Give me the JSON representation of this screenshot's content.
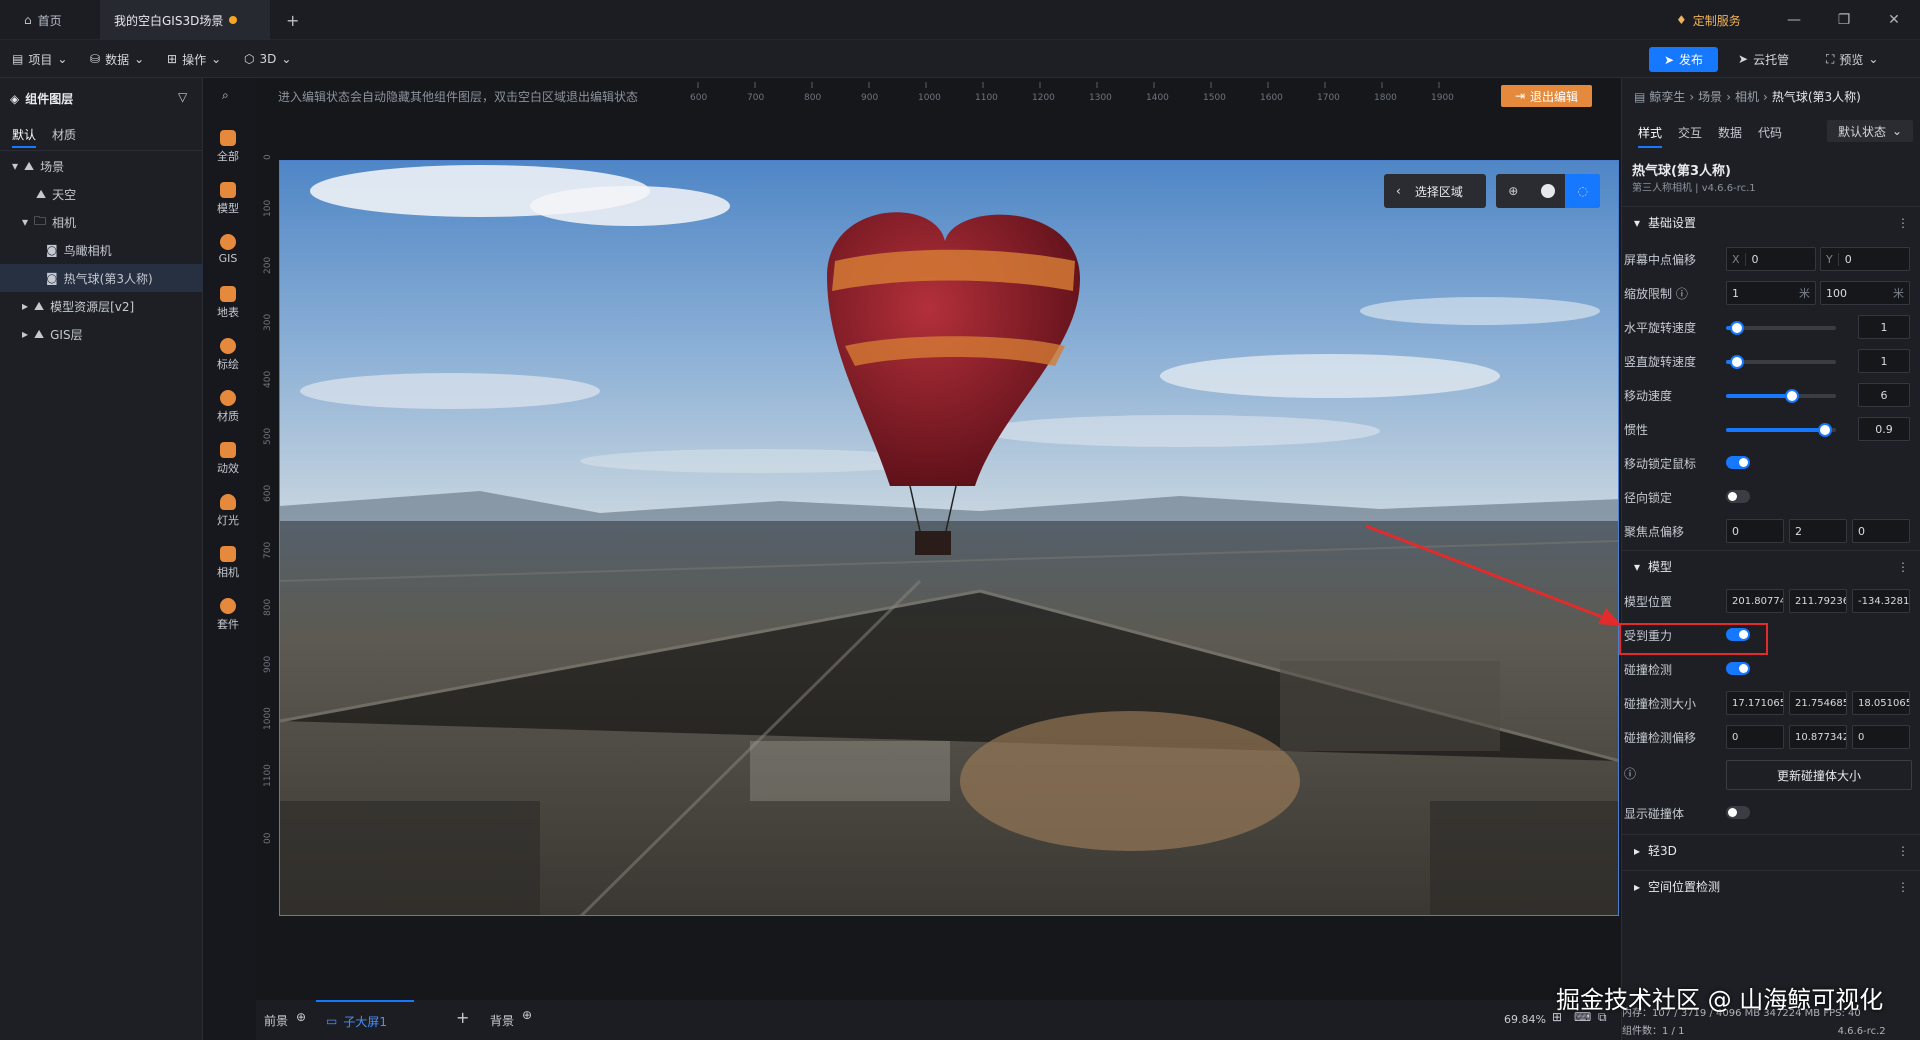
{
  "titlebar": {
    "home_tab": "首页",
    "scene_tab": "我的空白GIS3D场景",
    "custom_service": "定制服务"
  },
  "menubar": {
    "project": "项目",
    "data": "数据",
    "operate": "操作",
    "mode": "3D",
    "publish": "发布",
    "cloud": "云托管",
    "preview": "预览"
  },
  "left_panel": {
    "title": "组件图层",
    "tabs": [
      "默认",
      "材质"
    ],
    "tree": [
      {
        "label": "场景",
        "expanded": true
      },
      {
        "label": "天空"
      },
      {
        "label": "相机",
        "expanded": true
      },
      {
        "label": "鸟瞰相机"
      },
      {
        "label": "热气球(第3人称)",
        "selected": true
      },
      {
        "label": "模型资源层[v2]"
      },
      {
        "label": "GIS层"
      }
    ]
  },
  "icon_column": [
    "全部",
    "模型",
    "GIS",
    "地表",
    "标绘",
    "材质",
    "动效",
    "灯光",
    "相机",
    "套件"
  ],
  "canvas": {
    "hint": "进入编辑状态会自动隐藏其他组件图层，双击空白区域退出编辑状态",
    "exit_edit": "退出编辑",
    "select_region": "选择区域",
    "ruler_top": [
      "600",
      "700",
      "800",
      "900",
      "1000",
      "1100",
      "1200",
      "1300",
      "1400",
      "1500",
      "1600",
      "1700",
      "1800",
      "1900"
    ],
    "ruler_left": [
      "0",
      "100",
      "200",
      "300",
      "400",
      "500",
      "600",
      "700",
      "800",
      "900",
      "1000",
      "1100",
      "00"
    ]
  },
  "bottom": {
    "front": "前景",
    "sub_screen": "子大屏1",
    "background": "背景",
    "zoom": "69.84%"
  },
  "right_panel": {
    "breadcrumb": [
      "鲸孪生",
      "场景",
      "相机",
      "热气球(第3人称)"
    ],
    "tabs": [
      "样式",
      "交互",
      "数据",
      "代码"
    ],
    "state": "默认状态",
    "component_title": "热气球(第3人称)",
    "component_sub": "第三人称相机 | v4.6.6-rc.1",
    "section_basic": "基础设置",
    "screen_offset": {
      "label": "屏幕中点偏移",
      "x": "0",
      "y": "0"
    },
    "zoom_limit": {
      "label": "缩放限制",
      "min": "1",
      "max": "100",
      "unit": "米"
    },
    "h_rotate": {
      "label": "水平旋转速度",
      "value": "1",
      "ratio": 0.1
    },
    "v_rotate": {
      "label": "竖直旋转速度",
      "value": "1",
      "ratio": 0.1
    },
    "move_speed": {
      "label": "移动速度",
      "value": "6",
      "ratio": 0.6
    },
    "inertia": {
      "label": "惯性",
      "value": "0.9",
      "ratio": 0.9
    },
    "lock_mouse": {
      "label": "移动锁定鼠标",
      "on": true
    },
    "radial_lock": {
      "label": "径向锁定",
      "on": false
    },
    "focus_offset": {
      "label": "聚焦点偏移",
      "values": [
        "0",
        "2",
        "0"
      ]
    },
    "section_model": "模型",
    "model_pos": {
      "label": "模型位置",
      "values": [
        "201.80774",
        "211.79236",
        "-134.3281"
      ]
    },
    "gravity": {
      "label": "受到重力",
      "on": true
    },
    "collision": {
      "label": "碰撞检测",
      "on": true
    },
    "collision_size": {
      "label": "碰撞检测大小",
      "values": [
        "17.1710653",
        "21.754685",
        "18.051065"
      ]
    },
    "collision_offset": {
      "label": "碰撞检测偏移",
      "values": [
        "0",
        "10.877342",
        "0"
      ]
    },
    "update_btn": "更新碰撞体大小",
    "show_collider": {
      "label": "显示碰撞体",
      "on": false
    },
    "section_light3d": "轻3D",
    "section_space": "空间位置检测"
  },
  "status": {
    "memory": "内存：107 / 3719 / 4096 MB",
    "gpu": "347224 MB",
    "fps": "FPS: 40",
    "count": "组件数：1 / 1",
    "version": "4.6.6-rc.2"
  },
  "watermark": "掘金技术社区 @ 山海鲸可视化"
}
